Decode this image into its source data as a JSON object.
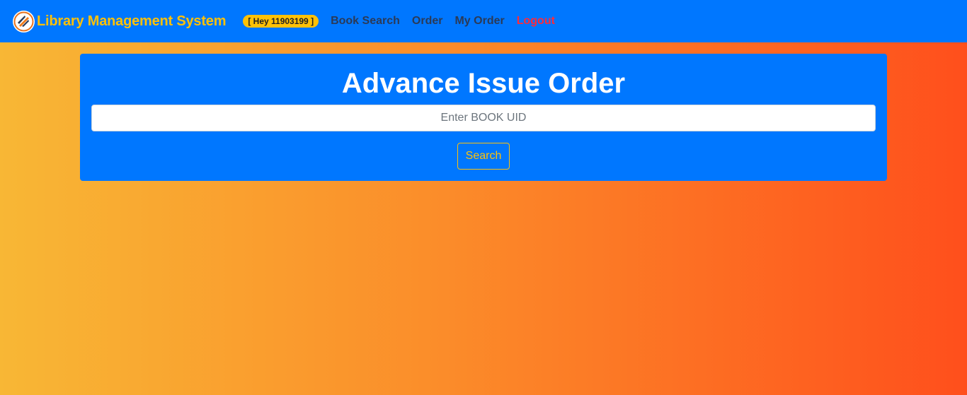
{
  "navbar": {
    "brand_title": "Library Management System",
    "user_badge": "[ Hey 11903199 ]",
    "links": {
      "book_search": "Book Search",
      "order": "Order",
      "my_order": "My Order",
      "logout": "Logout"
    }
  },
  "card": {
    "title": "Advance Issue Order",
    "uid_placeholder": "Enter BOOK UID",
    "uid_value": "",
    "search_label": "Search"
  },
  "colors": {
    "primary": "#0077ff",
    "accent": "#ffc107",
    "logout": "#ff2a3a",
    "gradient_start": "#f8b735",
    "gradient_end": "#ff4f1c"
  }
}
